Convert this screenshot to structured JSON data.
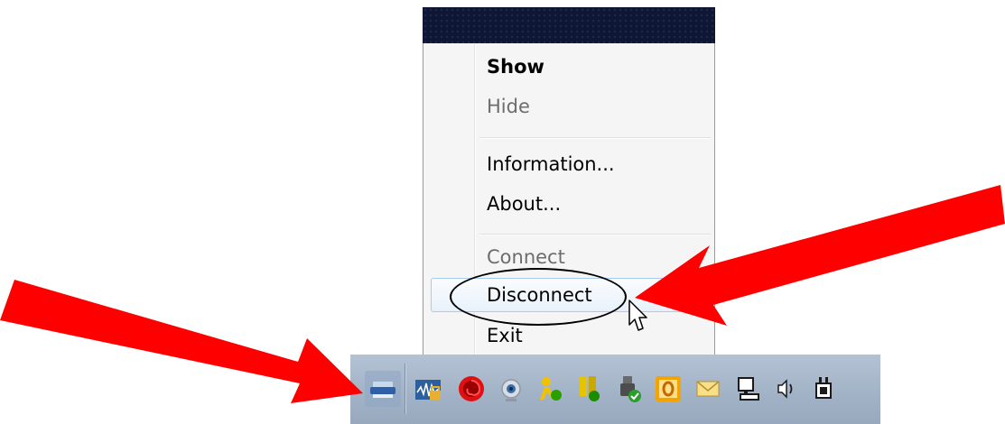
{
  "context_menu": {
    "items": [
      {
        "label": "Show",
        "style": "bold",
        "enabled": true
      },
      {
        "label": "Hide",
        "style": "normal",
        "enabled": false
      },
      {
        "label": "Information...",
        "style": "normal",
        "enabled": true
      },
      {
        "label": "About...",
        "style": "normal",
        "enabled": true
      },
      {
        "label": "Connect",
        "style": "normal",
        "enabled": false
      },
      {
        "label": "Disconnect",
        "style": "normal",
        "enabled": true,
        "highlighted": true
      },
      {
        "label": "Exit",
        "style": "normal",
        "enabled": true
      }
    ]
  },
  "taskbar": {
    "tray_icons": [
      "vpn-client-icon",
      "wireless-network-icon",
      "red-spiral-icon",
      "webcam-icon",
      "messenger-user-icon",
      "shield-status-icon",
      "usb-device-ok-icon",
      "outlook-icon",
      "mail-envelope-icon",
      "network-icon",
      "volume-icon",
      "power-plug-icon"
    ]
  },
  "annotations": {
    "arrow_color": "#ff0000",
    "ellipse_color": "#000000"
  },
  "colors": {
    "menu_background": "#f5f5f5",
    "menu_header": "#0e1633",
    "highlight_border": "#a9cbef",
    "taskbar": "#a2b2c6",
    "disabled_text": "#6d6d6d"
  }
}
